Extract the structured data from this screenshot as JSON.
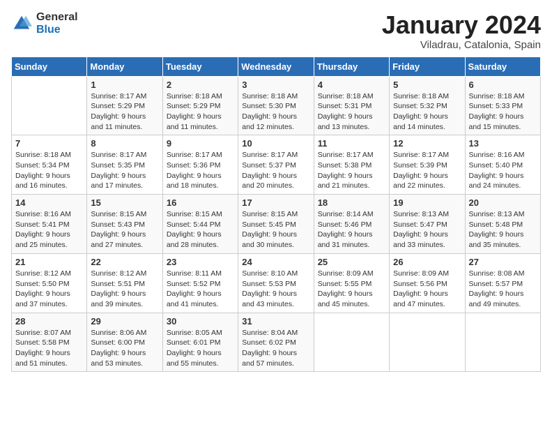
{
  "logo": {
    "general": "General",
    "blue": "Blue"
  },
  "header": {
    "month": "January 2024",
    "location": "Viladrau, Catalonia, Spain"
  },
  "weekdays": [
    "Sunday",
    "Monday",
    "Tuesday",
    "Wednesday",
    "Thursday",
    "Friday",
    "Saturday"
  ],
  "weeks": [
    [
      null,
      {
        "day": 1,
        "sunrise": "8:17 AM",
        "sunset": "5:29 PM",
        "daylight": "9 hours and 11 minutes."
      },
      {
        "day": 2,
        "sunrise": "8:18 AM",
        "sunset": "5:29 PM",
        "daylight": "9 hours and 11 minutes."
      },
      {
        "day": 3,
        "sunrise": "8:18 AM",
        "sunset": "5:30 PM",
        "daylight": "9 hours and 12 minutes."
      },
      {
        "day": 4,
        "sunrise": "8:18 AM",
        "sunset": "5:31 PM",
        "daylight": "9 hours and 13 minutes."
      },
      {
        "day": 5,
        "sunrise": "8:18 AM",
        "sunset": "5:32 PM",
        "daylight": "9 hours and 14 minutes."
      },
      {
        "day": 6,
        "sunrise": "8:18 AM",
        "sunset": "5:33 PM",
        "daylight": "9 hours and 15 minutes."
      }
    ],
    [
      {
        "day": 7,
        "sunrise": "8:18 AM",
        "sunset": "5:34 PM",
        "daylight": "9 hours and 16 minutes."
      },
      {
        "day": 8,
        "sunrise": "8:17 AM",
        "sunset": "5:35 PM",
        "daylight": "9 hours and 17 minutes."
      },
      {
        "day": 9,
        "sunrise": "8:17 AM",
        "sunset": "5:36 PM",
        "daylight": "9 hours and 18 minutes."
      },
      {
        "day": 10,
        "sunrise": "8:17 AM",
        "sunset": "5:37 PM",
        "daylight": "9 hours and 20 minutes."
      },
      {
        "day": 11,
        "sunrise": "8:17 AM",
        "sunset": "5:38 PM",
        "daylight": "9 hours and 21 minutes."
      },
      {
        "day": 12,
        "sunrise": "8:17 AM",
        "sunset": "5:39 PM",
        "daylight": "9 hours and 22 minutes."
      },
      {
        "day": 13,
        "sunrise": "8:16 AM",
        "sunset": "5:40 PM",
        "daylight": "9 hours and 24 minutes."
      }
    ],
    [
      {
        "day": 14,
        "sunrise": "8:16 AM",
        "sunset": "5:41 PM",
        "daylight": "9 hours and 25 minutes."
      },
      {
        "day": 15,
        "sunrise": "8:15 AM",
        "sunset": "5:43 PM",
        "daylight": "9 hours and 27 minutes."
      },
      {
        "day": 16,
        "sunrise": "8:15 AM",
        "sunset": "5:44 PM",
        "daylight": "9 hours and 28 minutes."
      },
      {
        "day": 17,
        "sunrise": "8:15 AM",
        "sunset": "5:45 PM",
        "daylight": "9 hours and 30 minutes."
      },
      {
        "day": 18,
        "sunrise": "8:14 AM",
        "sunset": "5:46 PM",
        "daylight": "9 hours and 31 minutes."
      },
      {
        "day": 19,
        "sunrise": "8:13 AM",
        "sunset": "5:47 PM",
        "daylight": "9 hours and 33 minutes."
      },
      {
        "day": 20,
        "sunrise": "8:13 AM",
        "sunset": "5:48 PM",
        "daylight": "9 hours and 35 minutes."
      }
    ],
    [
      {
        "day": 21,
        "sunrise": "8:12 AM",
        "sunset": "5:50 PM",
        "daylight": "9 hours and 37 minutes."
      },
      {
        "day": 22,
        "sunrise": "8:12 AM",
        "sunset": "5:51 PM",
        "daylight": "9 hours and 39 minutes."
      },
      {
        "day": 23,
        "sunrise": "8:11 AM",
        "sunset": "5:52 PM",
        "daylight": "9 hours and 41 minutes."
      },
      {
        "day": 24,
        "sunrise": "8:10 AM",
        "sunset": "5:53 PM",
        "daylight": "9 hours and 43 minutes."
      },
      {
        "day": 25,
        "sunrise": "8:09 AM",
        "sunset": "5:55 PM",
        "daylight": "9 hours and 45 minutes."
      },
      {
        "day": 26,
        "sunrise": "8:09 AM",
        "sunset": "5:56 PM",
        "daylight": "9 hours and 47 minutes."
      },
      {
        "day": 27,
        "sunrise": "8:08 AM",
        "sunset": "5:57 PM",
        "daylight": "9 hours and 49 minutes."
      }
    ],
    [
      {
        "day": 28,
        "sunrise": "8:07 AM",
        "sunset": "5:58 PM",
        "daylight": "9 hours and 51 minutes."
      },
      {
        "day": 29,
        "sunrise": "8:06 AM",
        "sunset": "6:00 PM",
        "daylight": "9 hours and 53 minutes."
      },
      {
        "day": 30,
        "sunrise": "8:05 AM",
        "sunset": "6:01 PM",
        "daylight": "9 hours and 55 minutes."
      },
      {
        "day": 31,
        "sunrise": "8:04 AM",
        "sunset": "6:02 PM",
        "daylight": "9 hours and 57 minutes."
      },
      null,
      null,
      null
    ]
  ]
}
